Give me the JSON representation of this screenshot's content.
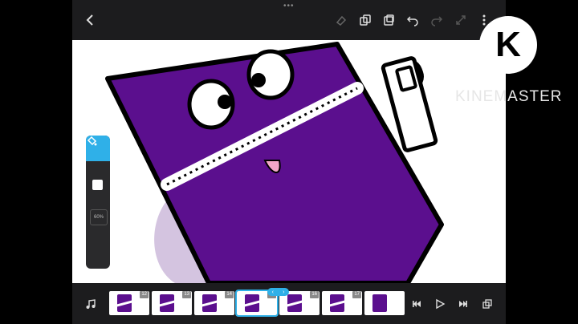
{
  "toolbar": {
    "back_icon": "chevron-left-icon",
    "eraser_icon": "eraser-icon",
    "copy_icon": "copy-icon",
    "paste_icon": "paste-icon",
    "undo_icon": "undo-icon",
    "redo_icon": "redo-icon",
    "transform_icon": "transform-icon",
    "more_icon": "more-vertical-icon"
  },
  "tools": {
    "fill_icon": "paint-bucket-icon",
    "active_color": "#2fb0e8",
    "brush_color": "#ffffff",
    "opacity_label": "60%"
  },
  "timeline": {
    "frames": [
      {
        "num": "12"
      },
      {
        "num": "13"
      },
      {
        "num": "14"
      },
      {
        "num": "15"
      },
      {
        "num": "16"
      },
      {
        "num": "17"
      },
      {
        "num": ""
      }
    ],
    "scrubber": {
      "left": "‹",
      "right": "›"
    }
  },
  "playback": {
    "music_icon": "music-note-icon",
    "first_icon": "skip-back-icon",
    "play_icon": "play-icon",
    "last_icon": "skip-forward-icon",
    "onion_icon": "onion-skin-icon"
  },
  "watermark": {
    "text": "KINEMASTER",
    "logo_letter": "K"
  },
  "colors": {
    "character_purple": "#5b0f8e",
    "ghost_purple": "#d4c4e0",
    "tongue_pink": "#f2a6c8"
  }
}
